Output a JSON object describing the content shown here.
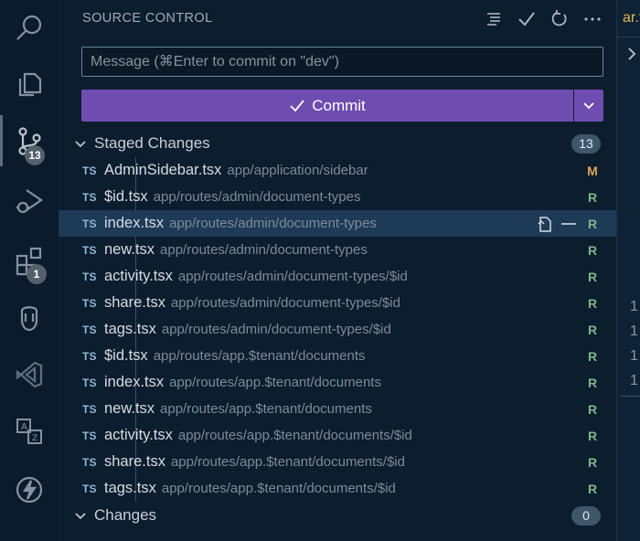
{
  "activity_bar": {
    "items": [
      {
        "icon": "search-icon"
      },
      {
        "icon": "explorer-icon"
      },
      {
        "icon": "source-control-icon",
        "badge": "13"
      },
      {
        "icon": "run-debug-icon"
      },
      {
        "icon": "extensions-icon",
        "badge": "1"
      },
      {
        "icon": "database-icon"
      },
      {
        "icon": "visual-studio-icon"
      },
      {
        "icon": "translate-icon"
      },
      {
        "icon": "lightning-icon"
      }
    ]
  },
  "panel": {
    "title": "SOURCE CONTROL",
    "header_actions": [
      "view-as-tree-icon",
      "check-icon",
      "refresh-icon",
      "more-icon"
    ],
    "message_placeholder": "Message (⌘Enter to commit on \"dev\")",
    "commit_label": "Commit"
  },
  "staged": {
    "label": "Staged Changes",
    "count": "13",
    "files": [
      {
        "lang": "TS",
        "name": "AdminSidebar.tsx",
        "path": "app/application/sidebar",
        "status": "M"
      },
      {
        "lang": "TS",
        "name": "$id.tsx",
        "path": "app/routes/admin/document-types",
        "status": "R"
      },
      {
        "lang": "TS",
        "name": "index.tsx",
        "path": "app/routes/admin/document-types",
        "status": "R",
        "selected": true
      },
      {
        "lang": "TS",
        "name": "new.tsx",
        "path": "app/routes/admin/document-types",
        "status": "R"
      },
      {
        "lang": "TS",
        "name": "activity.tsx",
        "path": "app/routes/admin/document-types/$id",
        "status": "R"
      },
      {
        "lang": "TS",
        "name": "share.tsx",
        "path": "app/routes/admin/document-types/$id",
        "status": "R"
      },
      {
        "lang": "TS",
        "name": "tags.tsx",
        "path": "app/routes/admin/document-types/$id",
        "status": "R"
      },
      {
        "lang": "TS",
        "name": "$id.tsx",
        "path": "app/routes/app.$tenant/documents",
        "status": "R"
      },
      {
        "lang": "TS",
        "name": "index.tsx",
        "path": "app/routes/app.$tenant/documents",
        "status": "R"
      },
      {
        "lang": "TS",
        "name": "new.tsx",
        "path": "app/routes/app.$tenant/documents",
        "status": "R"
      },
      {
        "lang": "TS",
        "name": "activity.tsx",
        "path": "app/routes/app.$tenant/documents/$id",
        "status": "R"
      },
      {
        "lang": "TS",
        "name": "share.tsx",
        "path": "app/routes/app.$tenant/documents/$id",
        "status": "R"
      },
      {
        "lang": "TS",
        "name": "tags.tsx",
        "path": "app/routes/app.$tenant/documents/$id",
        "status": "R"
      }
    ]
  },
  "changes": {
    "label": "Changes",
    "count": "0"
  },
  "editor": {
    "tab_fragment": "ar.t",
    "line_numbers": [
      "1",
      "1",
      "1",
      "1"
    ]
  },
  "colors": {
    "accent": "#6e4cb0",
    "background": "#0c1d2e",
    "selected_row": "#1d3a57",
    "renamed": "#7bb889",
    "modified": "#d9a45b"
  }
}
